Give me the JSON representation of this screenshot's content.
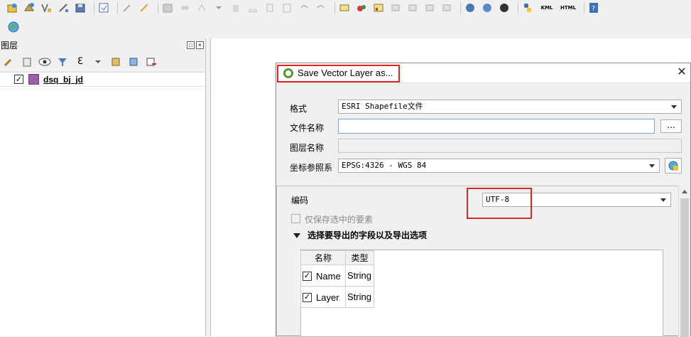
{
  "toolbar": {
    "icons": [
      "layer-open-icon",
      "layer-add-icon",
      "vector-add-icon",
      "digitize-icon",
      "save-layer-icon",
      "attribute-table-icon",
      "pencil-icon",
      "edit-icon",
      "save-edits-icon",
      "undo-icon",
      "redo-icon",
      "label-icon",
      "python-icon",
      "kml-icon",
      "html-icon",
      "help-icon"
    ],
    "kml_label": "KML",
    "html_label": "HTML"
  },
  "layers_panel": {
    "title": "图层",
    "layers": [
      {
        "name": "dsq_bj_jd",
        "checked": true,
        "color": "#9b5fa8"
      }
    ]
  },
  "dialog": {
    "title": "Save Vector Layer as...",
    "format_label": "格式",
    "format_value": "ESRI Shapefile文件",
    "filename_label": "文件名称",
    "filename_value": "",
    "browse_label": "...",
    "layername_label": "图层名称",
    "crs_label": "坐标参照系",
    "crs_value": "EPSG:4326 - WGS 84",
    "encoding_label": "编码",
    "encoding_value": "UTF-8",
    "only_selected_label": "仅保存选中的要素",
    "fields_section_title": "选择要导出的字段以及导出选项",
    "fields_table": {
      "headers": [
        "名称",
        "类型"
      ],
      "rows": [
        {
          "name": "Name",
          "type": "String",
          "checked": true
        },
        {
          "name": "Layer",
          "type": "String",
          "checked": true
        }
      ]
    }
  },
  "colors": {
    "highlight": "#e0242a",
    "qgis_green": "#589632",
    "layer_fill": "#9b5fa8"
  }
}
